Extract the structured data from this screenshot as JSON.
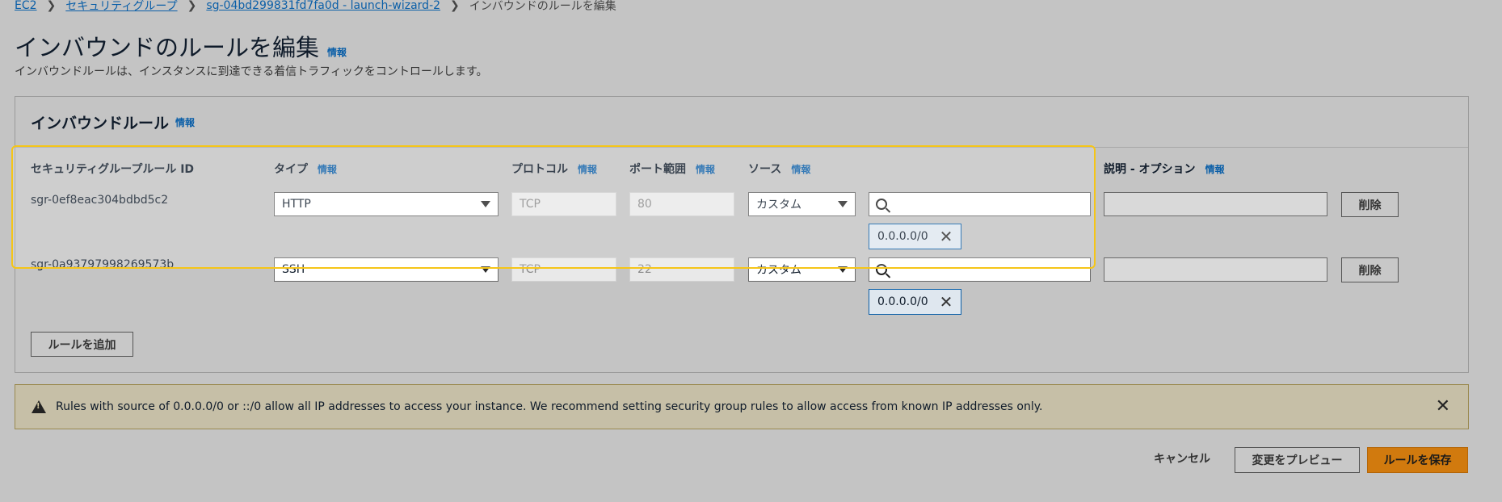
{
  "breadcrumb": {
    "items": [
      "EC2",
      "セキュリティグループ",
      "sg-04bd299831fd7fa0d - launch-wizard-2"
    ],
    "current": "インバウンドのルールを編集"
  },
  "page": {
    "title": "インバウンドのルールを編集",
    "info": "情報",
    "description": "インバウンドルールは、インスタンスに到達できる着信トラフィックをコントロールします。"
  },
  "panel": {
    "title": "インバウンドルール",
    "info": "情報",
    "columns": {
      "rule_id": "セキュリティグループルール ID",
      "type": "タイプ",
      "protocol": "プロトコル",
      "port_range": "ポート範囲",
      "source": "ソース",
      "description": "説明 - オプション",
      "info": "情報"
    },
    "rules": [
      {
        "id": "sgr-0ef8eac304bdbd5c2",
        "type": "HTTP",
        "protocol": "TCP",
        "port": "80",
        "source": "カスタム",
        "cidr": "0.0.0.0/0",
        "delete": "削除"
      },
      {
        "id": "sgr-0a93797998269573b",
        "type": "SSH",
        "protocol": "TCP",
        "port": "22",
        "source": "カスタム",
        "cidr": "0.0.0.0/0",
        "delete": "削除"
      }
    ],
    "add_rule": "ルールを追加"
  },
  "alert": {
    "message": "Rules with source of 0.0.0.0/0 or ::/0 allow all IP addresses to access your instance. We recommend setting security group rules to allow access from known IP addresses only."
  },
  "footer": {
    "cancel": "キャンセル",
    "preview": "変更をプレビュー",
    "save": "ルールを保存"
  }
}
